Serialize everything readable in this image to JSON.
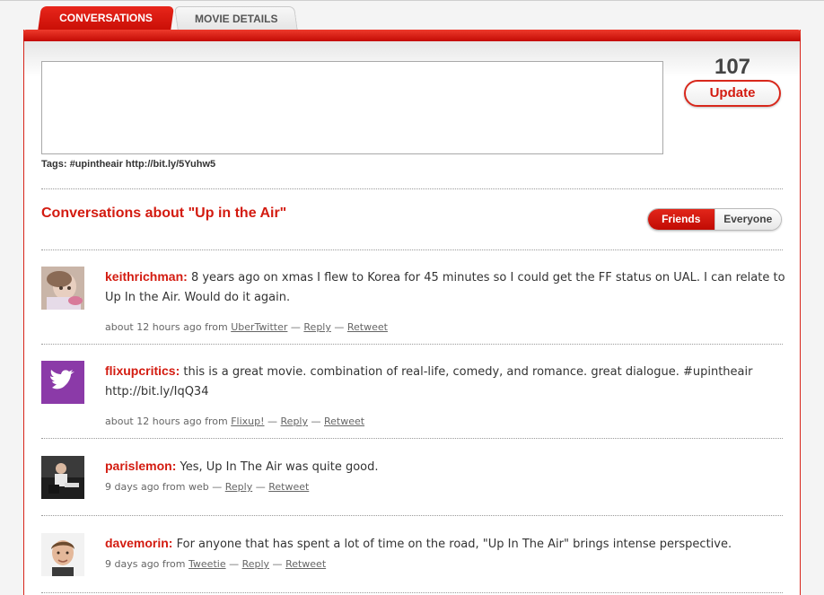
{
  "tabs": [
    {
      "label": "CONVERSATIONS",
      "active": true
    },
    {
      "label": "MOVIE DETAILS",
      "active": false
    }
  ],
  "compose": {
    "value": "",
    "tags_label": "Tags: #upintheair http://bit.ly/5Yuhw5",
    "char_count": "107",
    "update_label": "Update"
  },
  "section": {
    "title": "Conversations about \"Up in the Air\"",
    "toggle": [
      {
        "label": "Friends",
        "selected": true
      },
      {
        "label": "Everyone",
        "selected": false
      }
    ]
  },
  "conversations": [
    {
      "user": "keithrichman:",
      "text": " 8 years ago on xmas I flew to Korea for 45 minutes so I could get the FF status on UAL. I can relate to Up In the Air. Would do it again.",
      "time": "about 12 hours ago from ",
      "source": "UberTwitter",
      "reply": "Reply",
      "retweet": "Retweet",
      "avatar": "photo-avatar"
    },
    {
      "user": "flixupcritics:",
      "text": " this is a great movie. combination of real-life, comedy, and romance. great dialogue. #upintheair http://bit.ly/IqQ34",
      "time": "about 12 hours ago from ",
      "source": "Flixup!",
      "reply": "Reply",
      "retweet": "Retweet",
      "avatar": "twitter-bird-icon"
    },
    {
      "user": "parislemon:",
      "text": " Yes, Up In The Air was quite good.",
      "time": "9 days ago from web",
      "source": "",
      "reply": "Reply",
      "retweet": "Retweet",
      "avatar": "photo-avatar"
    },
    {
      "user": "davemorin:",
      "text": " For anyone that has spent a lot of time on the road, \"Up In The Air\" brings intense perspective.",
      "time": "9 days ago from ",
      "source": "Tweetie",
      "reply": "Reply",
      "retweet": "Retweet",
      "avatar": "photo-avatar"
    }
  ],
  "meta_sep": " — ",
  "colors": {
    "accent": "#d31b10",
    "tab_red": "#e0261b",
    "twitter_purple": "#8b3aa8"
  }
}
